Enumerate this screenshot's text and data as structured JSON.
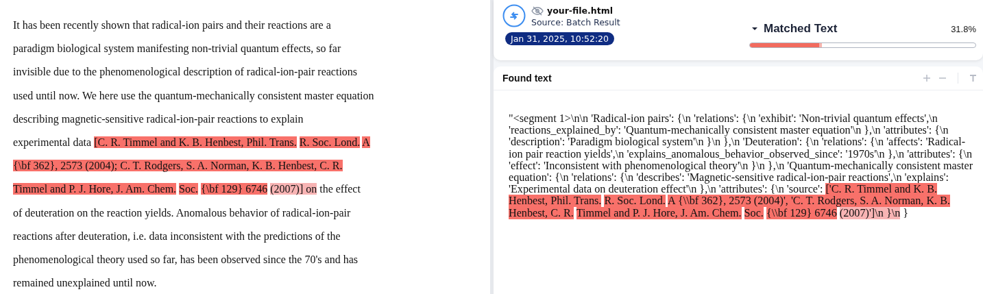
{
  "source_document": {
    "segments": [
      {
        "kind": "plain",
        "text": "It has been recently shown that radical-ion pairs and their reactions are a\nparadigm biological system manifesting non-trivial quantum effects, so far\ninvisible due to the phenomenological description of radical-ion-pair reactions\nused until now. We here use the quantum-mechanically consistent master equation\ndescribing magnetic-sensitive radical-ion-pair reactions to explain\nexperimental data "
      },
      {
        "kind": "match",
        "text": "[C. R. Timmel and K. B. Henbest, Phil. Trans."
      },
      {
        "kind": "match",
        "text": "R. Soc. Lond."
      },
      {
        "kind": "match",
        "text": "A\n{\\bf 362}, 2573 (2004); C. T. Rodgers, S. A. Norman, K. B. Henbest, C. R.\nTimmel and P. J. Hore, J. Am. Chem."
      },
      {
        "kind": "match",
        "text": "Soc."
      },
      {
        "kind": "match",
        "text": "{\\bf 129} 6746"
      },
      {
        "kind": "partial",
        "text": "(2007)] on"
      },
      {
        "kind": "plain",
        "text": " the effect\nof deuteration on the reaction yields. Anomalous behavior of radical-ion-pair\nreactions after deuteration, i.e. data inconsistent with the predictions of the\nphenomenological theory used so far, has been observed since the 70's and has\nremained unexplained until now."
      }
    ]
  },
  "result_card": {
    "file_name": "your-file.html",
    "source": "Source: Batch Result",
    "date": "Jan 31, 2025, 10:52:20",
    "metric": {
      "label": "Matched Text",
      "percent": "31.8%",
      "level": 0.318
    }
  },
  "found_text": {
    "title": "Found text",
    "segments": [
      {
        "kind": "plain",
        "text": "\"<segment 1>\\n\\n 'Radical-ion pairs': {\\n 'relations': {\\n 'exhibit': 'Non-trivial quantum effects',\\n 'reactions_explained_by': 'Quantum-mechanically consistent master equation'\\n },\\n 'attributes': {\\n 'description': 'Paradigm biological system'\\n }\\n },\\n 'Deuteration': {\\n 'relations': {\\n 'affects': 'Radical-ion pair reaction yields',\\n 'explains_anomalous_behavior_observed_since': '1970s'\\n },\\n 'attributes': {\\n 'effect': 'Inconsistent with phenomenological theory'\\n }\\n },\\n 'Quantum-mechanically consistent master equation': {\\n 'relations': {\\n 'describes': 'Magnetic-sensitive radical-ion-pair reactions',\\n 'explains': 'Experimental data on deuteration effect'\\n },\\n 'attributes': {\\n 'source': "
      },
      {
        "kind": "match",
        "text": "['C. R. Timmel and K. B. Henbest, Phil. Trans."
      },
      {
        "kind": "match",
        "text": "R. Soc. Lond."
      },
      {
        "kind": "match",
        "text": "A {\\\\bf 362}, 2573 (2004)', 'C. T. Rodgers, S. A. Norman, K. B. Henbest, C. R."
      },
      {
        "kind": "match",
        "text": "Timmel and P. J. Hore, J. Am. Chem."
      },
      {
        "kind": "match",
        "text": "Soc."
      },
      {
        "kind": "match",
        "text": "{\\\\bf 129} 6746"
      },
      {
        "kind": "partial",
        "text": "(2007)']\\n }\\n"
      },
      {
        "kind": "plain",
        "text": " }"
      }
    ]
  }
}
